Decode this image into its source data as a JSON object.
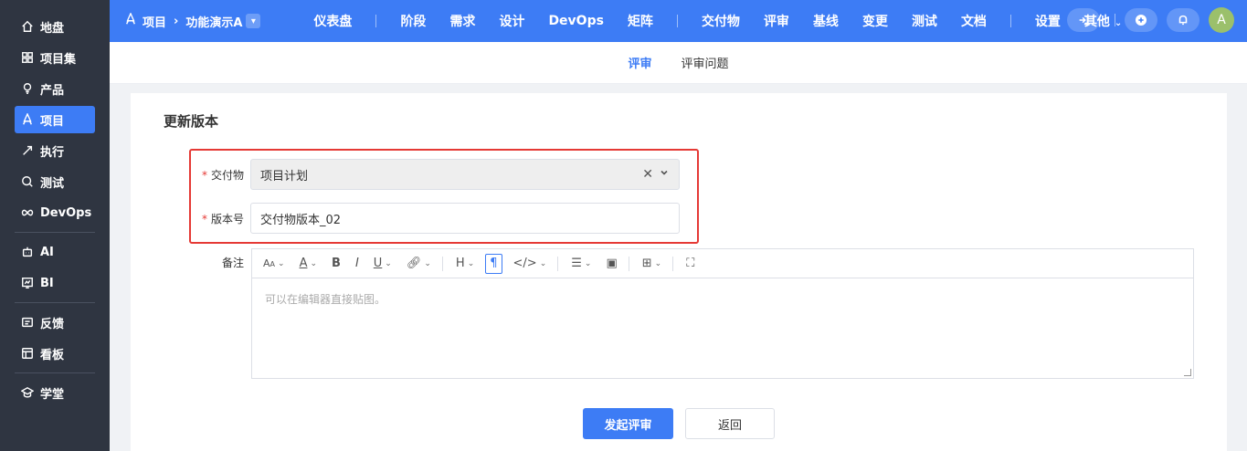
{
  "sidebar": {
    "items": [
      {
        "label": "地盘",
        "icon": "home-icon"
      },
      {
        "label": "项目集",
        "icon": "grid-icon"
      },
      {
        "label": "产品",
        "icon": "bulb-icon"
      },
      {
        "label": "项目",
        "icon": "rocket-icon"
      },
      {
        "label": "执行",
        "icon": "run-icon"
      },
      {
        "label": "测试",
        "icon": "search-icon"
      },
      {
        "label": "DevOps",
        "icon": "infinity-icon"
      },
      {
        "label": "AI",
        "icon": "robot-icon"
      },
      {
        "label": "BI",
        "icon": "chart-icon"
      },
      {
        "label": "反馈",
        "icon": "feedback-icon"
      },
      {
        "label": "看板",
        "icon": "board-icon"
      },
      {
        "label": "学堂",
        "icon": "school-icon"
      }
    ]
  },
  "topnav": {
    "crumb_root": "项目",
    "crumb_project": "功能演示A",
    "items": [
      "仪表盘",
      "阶段",
      "需求",
      "设计",
      "DevOps",
      "矩阵",
      "交付物",
      "评审",
      "基线",
      "变更",
      "测试",
      "文档",
      "设置",
      "其他"
    ],
    "avatar": "A"
  },
  "subtabs": [
    "评审",
    "评审问题"
  ],
  "form": {
    "title": "更新版本",
    "deliverable_label": "交付物",
    "deliverable_value": "项目计划",
    "version_label": "版本号",
    "version_value": "交付物版本_02",
    "note_label": "备注",
    "editor_placeholder": "可以在编辑器直接贴图。",
    "submit_label": "发起评审",
    "back_label": "返回"
  },
  "colors": {
    "accent": "#3d7cf5",
    "sidebar": "#2f3541",
    "highlight": "#e53935"
  }
}
